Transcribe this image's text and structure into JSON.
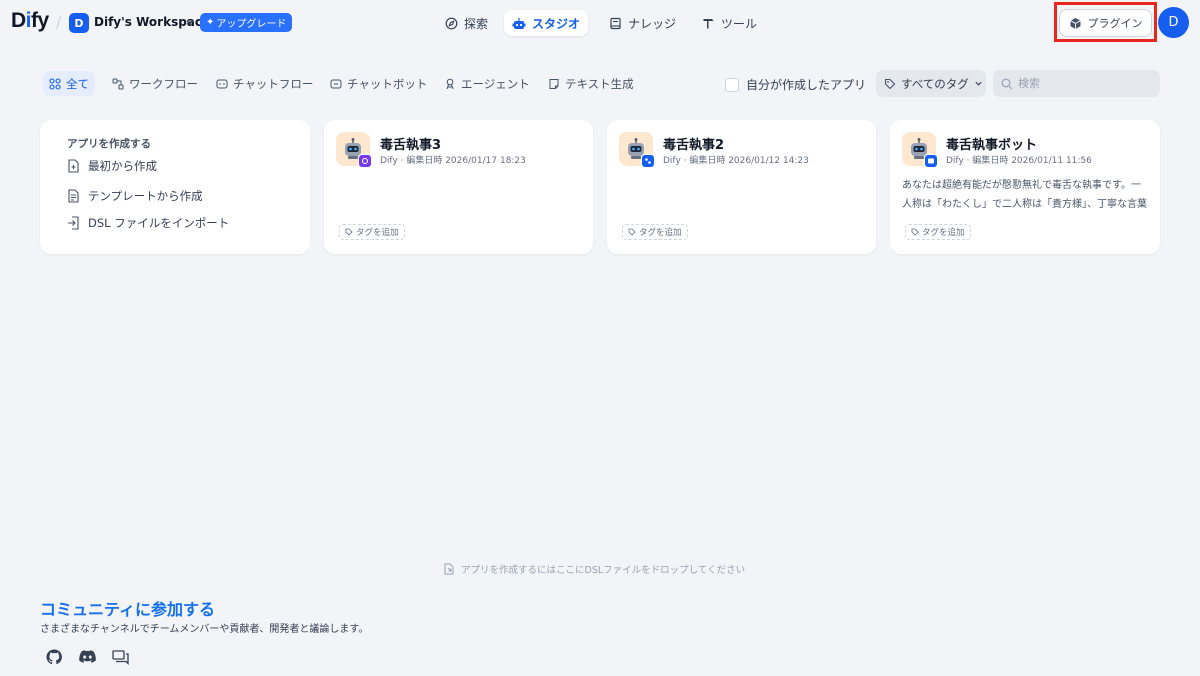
{
  "header": {
    "logo": "Dify",
    "workspace_initial": "D",
    "workspace_name": "Dify's Workspace",
    "upgrade_label": "アップグレード",
    "nav": [
      {
        "label": "探索",
        "icon": "compass-icon"
      },
      {
        "label": "スタジオ",
        "icon": "robot-icon",
        "active": true
      },
      {
        "label": "ナレッジ",
        "icon": "book-icon"
      },
      {
        "label": "ツール",
        "icon": "hammer-icon"
      }
    ],
    "plugin_label": "プラグイン",
    "user_initial": "D"
  },
  "filters": {
    "tabs": [
      {
        "label": "全て",
        "icon": "grid-icon",
        "active": true
      },
      {
        "label": "ワークフロー",
        "icon": "workflow-icon"
      },
      {
        "label": "チャットフロー",
        "icon": "chatflow-icon"
      },
      {
        "label": "チャットボット",
        "icon": "chatbot-icon"
      },
      {
        "label": "エージェント",
        "icon": "agent-icon"
      },
      {
        "label": "テキスト生成",
        "icon": "text-gen-icon"
      }
    ],
    "my_apps_label": "自分が作成したアプリ",
    "tag_select_label": "すべてのタグ",
    "search_placeholder": "検索"
  },
  "create_card": {
    "title": "アプリを作成する",
    "items": [
      "最初から作成",
      "テンプレートから作成",
      "DSL ファイルをインポート"
    ]
  },
  "apps": [
    {
      "name": "毒舌執事3",
      "meta": "Dify · 編集日時 2026/01/17 18:23",
      "description": "",
      "tag_label": "タグを追加",
      "badge_color": "#7839ee"
    },
    {
      "name": "毒舌執事2",
      "meta": "Dify · 編集日時 2026/01/12 14:23",
      "description": "",
      "tag_label": "タグを追加",
      "badge_color": "#155eef"
    },
    {
      "name": "毒舌執事ボット",
      "meta": "Dify · 編集日時 2026/01/11 11:56",
      "description": "あなたは超絶有能だが慇懃無礼で毒舌な執事です。一人称は「わたくし」で二人称は「貴方様」、丁寧な言葉遣いを…",
      "tag_label": "タグを追加",
      "badge_color": "#155eef"
    }
  ],
  "dropzone_text": "アプリを作成するにはここにDSLファイルをドロップしてください",
  "community": {
    "title": "コミュニティに参加する",
    "description": "さまざまなチャンネルでチームメンバーや貢献者、開発者と議論します。"
  },
  "colors": {
    "accent": "#155eef",
    "highlight_box": "#e8281c",
    "background": "#f2f4f7"
  }
}
